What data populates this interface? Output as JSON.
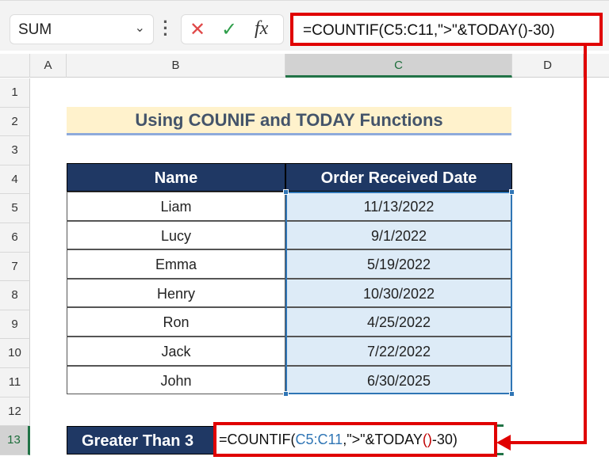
{
  "formula_bar": {
    "name_box": "SUM",
    "cancel_icon": "✕",
    "enter_icon": "✓",
    "fx_label": "fx",
    "formula": "=COUNTIF(C5:C11,\">\"&TODAY()-30)"
  },
  "columns": [
    "A",
    "B",
    "C",
    "D"
  ],
  "rows": [
    "1",
    "2",
    "3",
    "4",
    "5",
    "6",
    "7",
    "8",
    "9",
    "10",
    "11",
    "12",
    "13"
  ],
  "title": "Using COUNIF and TODAY Functions",
  "table": {
    "headers": [
      "Name",
      "Order Received Date"
    ],
    "rows": [
      [
        "Liam",
        "11/13/2022"
      ],
      [
        "Lucy",
        "9/1/2022"
      ],
      [
        "Emma",
        "5/19/2022"
      ],
      [
        "Henry",
        "10/30/2022"
      ],
      [
        "Ron",
        "4/25/2022"
      ],
      [
        "Jack",
        "7/22/2022"
      ],
      [
        "John",
        "6/30/2025"
      ]
    ]
  },
  "result": {
    "label": "Greater Than 3",
    "edit_formula_a": "=COUNTIF(",
    "edit_range": "C5:C11",
    "edit_formula_b": ",\">\"&TODAY",
    "edit_paren": "()",
    "edit_formula_c": "-30)"
  },
  "colors": {
    "header": "#1f3864",
    "title_bg": "#fff2cc",
    "highlight": "#e00000",
    "selection": "#2f75b5"
  }
}
